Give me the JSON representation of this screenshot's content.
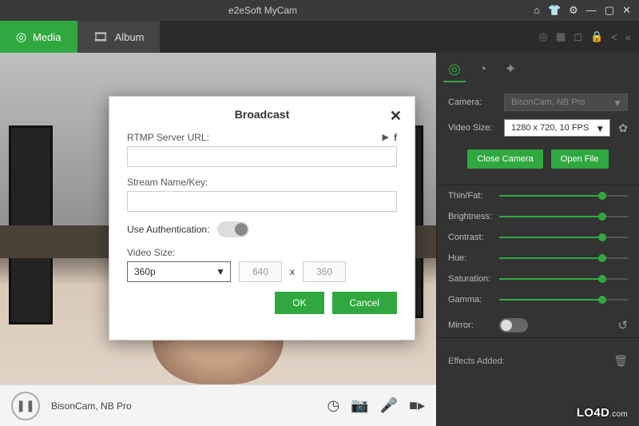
{
  "titlebar": {
    "title": "e2eSoft MyCam"
  },
  "tabs": {
    "media": "Media",
    "album": "Album"
  },
  "bottom": {
    "camera_name": "BisonCam, NB Pro"
  },
  "right": {
    "camera_label": "Camera:",
    "camera_value": "BisonCam, NB Pro",
    "videosize_label": "Video Size:",
    "videosize_value": "1280 x 720, 10 FPS",
    "close_camera": "Close Camera",
    "open_file": "Open File",
    "mirror_label": "Mirror:",
    "effects_label": "Effects Added:"
  },
  "sliders": [
    {
      "label": "Thin/Fat:",
      "value": 80
    },
    {
      "label": "Brightness:",
      "value": 80
    },
    {
      "label": "Contrast:",
      "value": 80
    },
    {
      "label": "Hue:",
      "value": 80
    },
    {
      "label": "Saturation:",
      "value": 80
    },
    {
      "label": "Gamma:",
      "value": 80
    }
  ],
  "dialog": {
    "title": "Broadcast",
    "rtmp_label": "RTMP Server URL:",
    "stream_label": "Stream Name/Key:",
    "auth_label": "Use Authentication:",
    "vsize_label": "Video Size:",
    "vsize_value": "360p",
    "dim_w": "640",
    "dim_x": "x",
    "dim_h": "360",
    "ok": "OK",
    "cancel": "Cancel"
  },
  "watermark": "LO4D",
  "watermark_tld": ".com"
}
